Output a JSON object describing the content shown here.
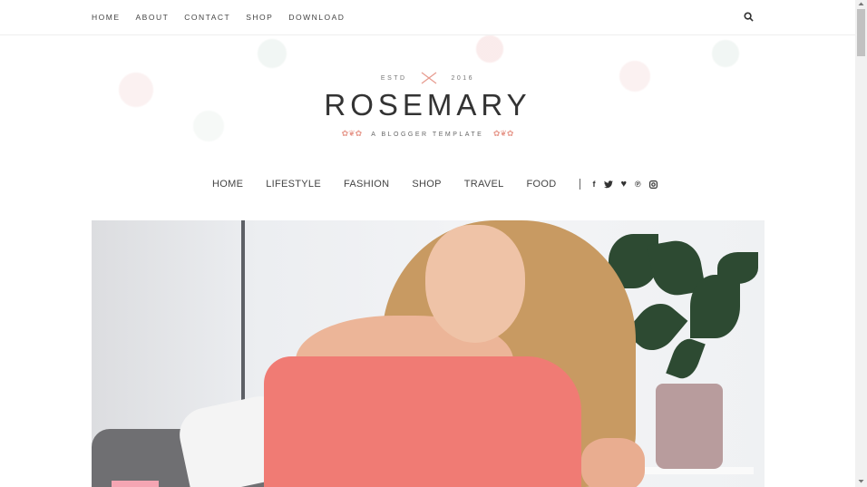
{
  "topnav": [
    "HOME",
    "ABOUT",
    "CONTACT",
    "SHOP",
    "DOWNLOAD"
  ],
  "header": {
    "estd_left": "ESTD",
    "estd_right": "2016",
    "logo": "ROSEMARY",
    "tagline": "A BLOGGER TEMPLATE"
  },
  "mainnav": [
    "HOME",
    "LIFESTYLE",
    "FASHION",
    "SHOP",
    "TRAVEL",
    "FOOD"
  ],
  "social_icons": [
    "facebook-icon",
    "twitter-icon",
    "heart-icon",
    "pinterest-icon",
    "instagram-icon"
  ],
  "colors": {
    "accent": "#e79a8e",
    "badge": "#f5a5b3",
    "text": "#333333"
  }
}
